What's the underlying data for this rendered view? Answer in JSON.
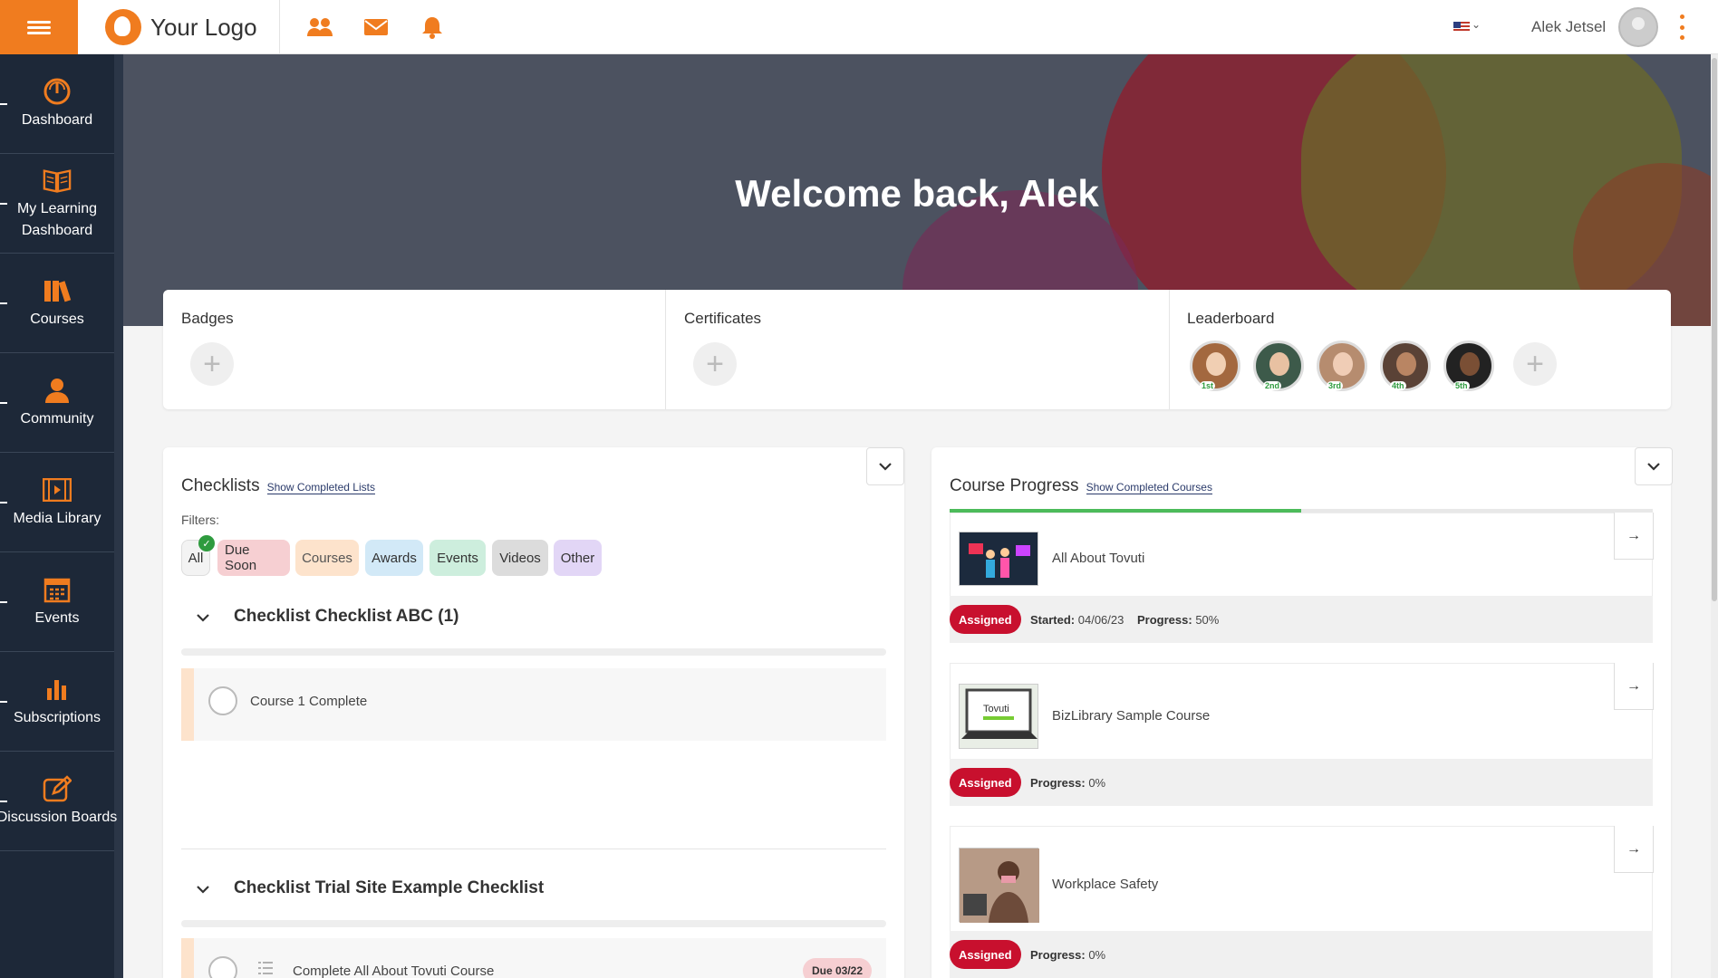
{
  "brand": {
    "logo_text": "Your Logo",
    "accent": "#f07c1f",
    "sidebar_bg": "#1d2838"
  },
  "topbar": {
    "icons": [
      "users-icon",
      "mail-icon",
      "bell-icon"
    ],
    "user_name": "Alek Jetsel",
    "language_flag": "us-flag-icon"
  },
  "sidebar": {
    "items": [
      {
        "label": "Dashboard",
        "icon": "dashboard-gauge-icon"
      },
      {
        "label": "My Learning Dashboard",
        "icon": "open-book-icon"
      },
      {
        "label": "Courses",
        "icon": "books-icon"
      },
      {
        "label": "Community",
        "icon": "person-icon"
      },
      {
        "label": "Media Library",
        "icon": "film-icon"
      },
      {
        "label": "Events",
        "icon": "calendar-icon"
      },
      {
        "label": "Subscriptions",
        "icon": "bar-chart-icon"
      },
      {
        "label": "Discussion Boards",
        "icon": "edit-board-icon"
      }
    ]
  },
  "hero": {
    "welcome": "Welcome back, Alek"
  },
  "summary": {
    "badges_title": "Badges",
    "certificates_title": "Certificates",
    "leaderboard_title": "Leaderboard",
    "leaderboard_ranks": [
      "1st",
      "2nd",
      "3rd",
      "4th",
      "5th"
    ]
  },
  "checklists": {
    "title": "Checklists",
    "show_completed": "Show Completed Lists",
    "filters_label": "Filters:",
    "filters": [
      {
        "label": "All",
        "bg": "#f3f3f3",
        "color": "#333"
      },
      {
        "label": "Due Soon",
        "bg": "#f6cfd2",
        "color": "#333"
      },
      {
        "label": "Courses",
        "bg": "#fde3cc",
        "color": "#555"
      },
      {
        "label": "Awards",
        "bg": "#d2e9f7",
        "color": "#333"
      },
      {
        "label": "Events",
        "bg": "#cdeedd",
        "color": "#333"
      },
      {
        "label": "Videos",
        "bg": "#dcdcdc",
        "color": "#333"
      },
      {
        "label": "Other",
        "bg": "#e2d6f6",
        "color": "#333"
      }
    ],
    "groups": [
      {
        "name": "Checklist Checklist ABC (1)",
        "items": [
          {
            "label": "Course 1 Complete"
          }
        ]
      },
      {
        "name": "Checklist Trial Site Example Checklist",
        "items": [
          {
            "label": "Complete All About Tovuti Course",
            "due": "Due 03/22"
          }
        ]
      }
    ]
  },
  "course_progress": {
    "title": "Course Progress",
    "show_completed": "Show Completed Courses",
    "overall_progress": 0.5,
    "courses": [
      {
        "name": "All About Tovuti",
        "status": "Assigned",
        "started_label": "Started:",
        "started": "04/06/23",
        "progress_label": "Progress:",
        "progress": "50%"
      },
      {
        "name": "BizLibrary Sample Course",
        "status": "Assigned",
        "progress_label": "Progress:",
        "progress": "0%"
      },
      {
        "name": "Workplace Safety",
        "status": "Assigned",
        "progress_label": "Progress:",
        "progress": "0%"
      }
    ]
  }
}
